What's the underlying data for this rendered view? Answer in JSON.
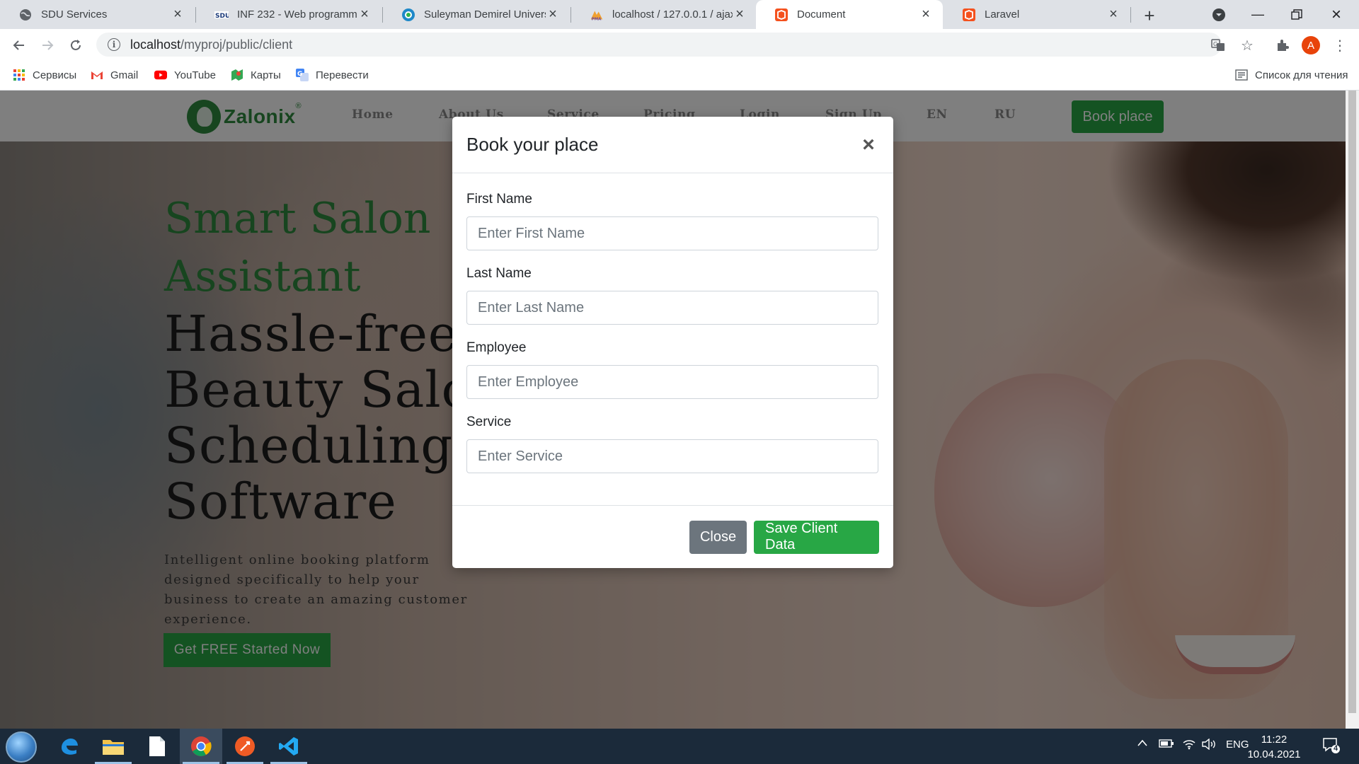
{
  "browser": {
    "tabs": [
      {
        "title": "SDU Services",
        "icon": "globe-icon"
      },
      {
        "title": "INF 232 - Web programming",
        "icon": "sdu-icon"
      },
      {
        "title": "Suleyman Demirel University",
        "icon": "sdu-circle-icon"
      },
      {
        "title": "localhost / 127.0.0.1 / ajax /",
        "icon": "phpmyadmin-icon"
      },
      {
        "title": "Document",
        "icon": "laravel-icon"
      },
      {
        "title": "Laravel",
        "icon": "laravel-icon"
      }
    ],
    "active_tab": 4,
    "url_host": "localhost",
    "url_path": "/myproj/public/client",
    "profile_initial": "A",
    "bookmarks": [
      {
        "label": "Сервисы",
        "icon": "apps-grid-icon"
      },
      {
        "label": "Gmail",
        "icon": "gmail-icon"
      },
      {
        "label": "YouTube",
        "icon": "youtube-icon"
      },
      {
        "label": "Карты",
        "icon": "maps-icon"
      },
      {
        "label": "Перевести",
        "icon": "translate-icon"
      }
    ],
    "reading_list": "Список для чтения"
  },
  "site": {
    "logo_text": "Zalonix",
    "logo_reg": "®",
    "nav": [
      "Home",
      "About Us",
      "Service",
      "Pricing",
      "Login",
      "Sign Up",
      "EN",
      "RU"
    ],
    "nav_button": "Book place",
    "hero": {
      "eyebrow": "Smart Salon Assistant",
      "title": "Hassle-free Beauty Salon Scheduling Software",
      "subtitle": "Intelligent online booking platform designed specifically to help your business to create an amazing customer experience.",
      "cta": "Get FREE Started Now"
    }
  },
  "modal": {
    "title": "Book your place",
    "close_glyph": "×",
    "fields": [
      {
        "label": "First Name",
        "placeholder": "Enter First Name",
        "value": ""
      },
      {
        "label": "Last Name",
        "placeholder": "Enter Last Name",
        "value": ""
      },
      {
        "label": "Employee",
        "placeholder": "Enter Employee",
        "value": ""
      },
      {
        "label": "Service",
        "placeholder": "Enter Service",
        "value": ""
      }
    ],
    "close_button": "Close",
    "save_button": "Save Client Data"
  },
  "taskbar": {
    "apps": [
      "edge-icon",
      "file-explorer-icon",
      "notepad-icon",
      "chrome-icon",
      "postman-icon",
      "vscode-icon"
    ],
    "language": "ENG",
    "time": "11:22",
    "date": "10.04.2021",
    "notifications": "4"
  },
  "colors": {
    "brand_green": "#28a745",
    "logo_green": "#2e8b3e",
    "secondary": "#6c757d",
    "taskbar": "#1b2a3a"
  }
}
